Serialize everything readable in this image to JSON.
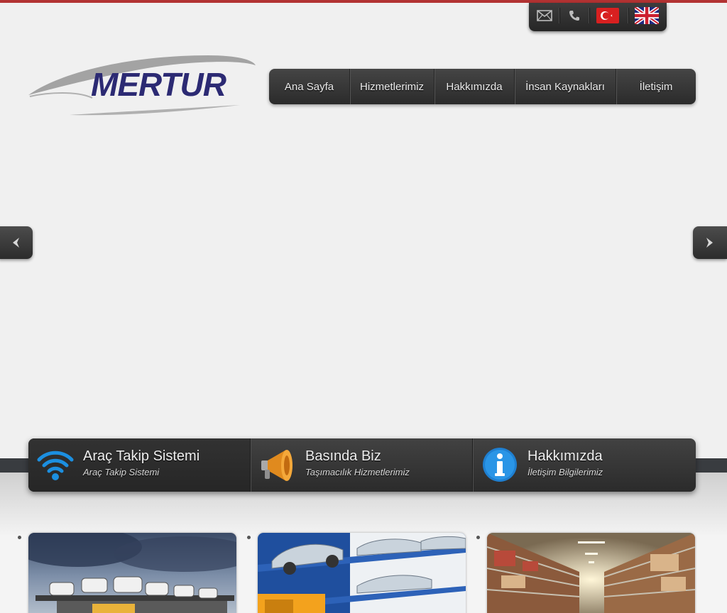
{
  "brand": {
    "logo_text": "MERTUR"
  },
  "utility": {
    "items": [
      {
        "icon": "mail-icon"
      },
      {
        "icon": "phone-icon"
      },
      {
        "icon": "flag-tr-icon"
      },
      {
        "icon": "flag-uk-icon"
      }
    ]
  },
  "nav": {
    "items": [
      {
        "label": "Ana Sayfa"
      },
      {
        "label": "Hizmetlerimiz"
      },
      {
        "label": "Hakkımızda"
      },
      {
        "label": "İnsan Kaynakları"
      },
      {
        "label": "İletişim"
      }
    ]
  },
  "slider": {
    "prev_icon": "chevron-left-icon",
    "next_icon": "chevron-right-icon"
  },
  "features": [
    {
      "title": "Araç Takip Sistemi",
      "subtitle": "Araç Takip Sistemi",
      "icon": "wifi-icon"
    },
    {
      "title": "Basında Biz",
      "subtitle": "Taşımacılık Hizmetlerimiz",
      "icon": "megaphone-icon"
    },
    {
      "title": "Hakkımızda",
      "subtitle": "İletişim Bilgilerimiz",
      "icon": "info-icon"
    }
  ],
  "gallery": [
    {
      "image": "car-carrier-trucks-photo"
    },
    {
      "image": "car-transporter-truck-photo"
    },
    {
      "image": "warehouse-shelves-photo"
    }
  ],
  "colors": {
    "top_strip": "#b23232",
    "dark_bar": "#333333",
    "logo_blue": "#2c2a73",
    "logo_swoosh": "#9a9a9a",
    "wifi_blue": "#1c8fe0",
    "info_blue": "#1f7fd0"
  }
}
